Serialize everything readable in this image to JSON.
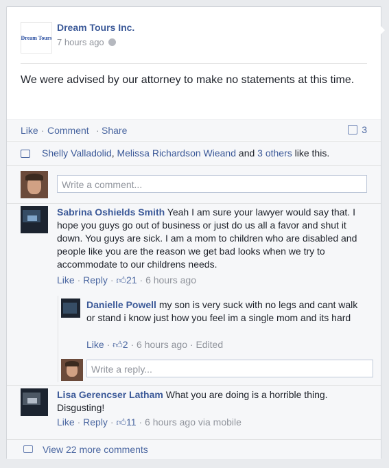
{
  "post": {
    "page_name": "Dream Tours Inc.",
    "logo_text": "Dream Tours",
    "time": "7 hours ago",
    "text": "We were advised by our attorney to make no statements at this time."
  },
  "actions": {
    "like": "Like",
    "comment": "Comment",
    "share": "Share",
    "comment_count": "3"
  },
  "likes": {
    "name1": "Shelly Valladolid",
    "name2": "Melissa Richardson Wieand",
    "and": "and",
    "others": "3 others",
    "suffix": "like this."
  },
  "comment_input": {
    "placeholder": "Write a comment..."
  },
  "comments": [
    {
      "name": "Sabrina Oshields Smith",
      "text": "Yeah I am sure your lawyer would say that. I hope you guys go out of business or just do us all a favor and shut it down. You guys are sick. I am a mom to children who are disabled and people like you are the reason we get bad looks when we try to accommodate to our childrens needs.",
      "like": "Like",
      "reply": "Reply",
      "likes": "21",
      "time": "6 hours ago"
    },
    {
      "name": "Lisa Gerencser Latham",
      "text": "What you are doing is a horrible thing. Disgusting!",
      "like": "Like",
      "reply": "Reply",
      "likes": "11",
      "time": "6 hours ago via mobile"
    }
  ],
  "reply": {
    "name": "Danielle Powell",
    "text": "my son is very suck with no legs and cant walk or stand i know just how you feel im a single mom and its hard",
    "like": "Like",
    "likes": "2",
    "time": "6 hours ago",
    "edited": "Edited",
    "input_placeholder": "Write a reply..."
  },
  "more": {
    "label": "View 22 more comments"
  },
  "colors": {
    "link": "#3b5998",
    "bg": "#f6f7f9",
    "meta": "#90949c"
  }
}
